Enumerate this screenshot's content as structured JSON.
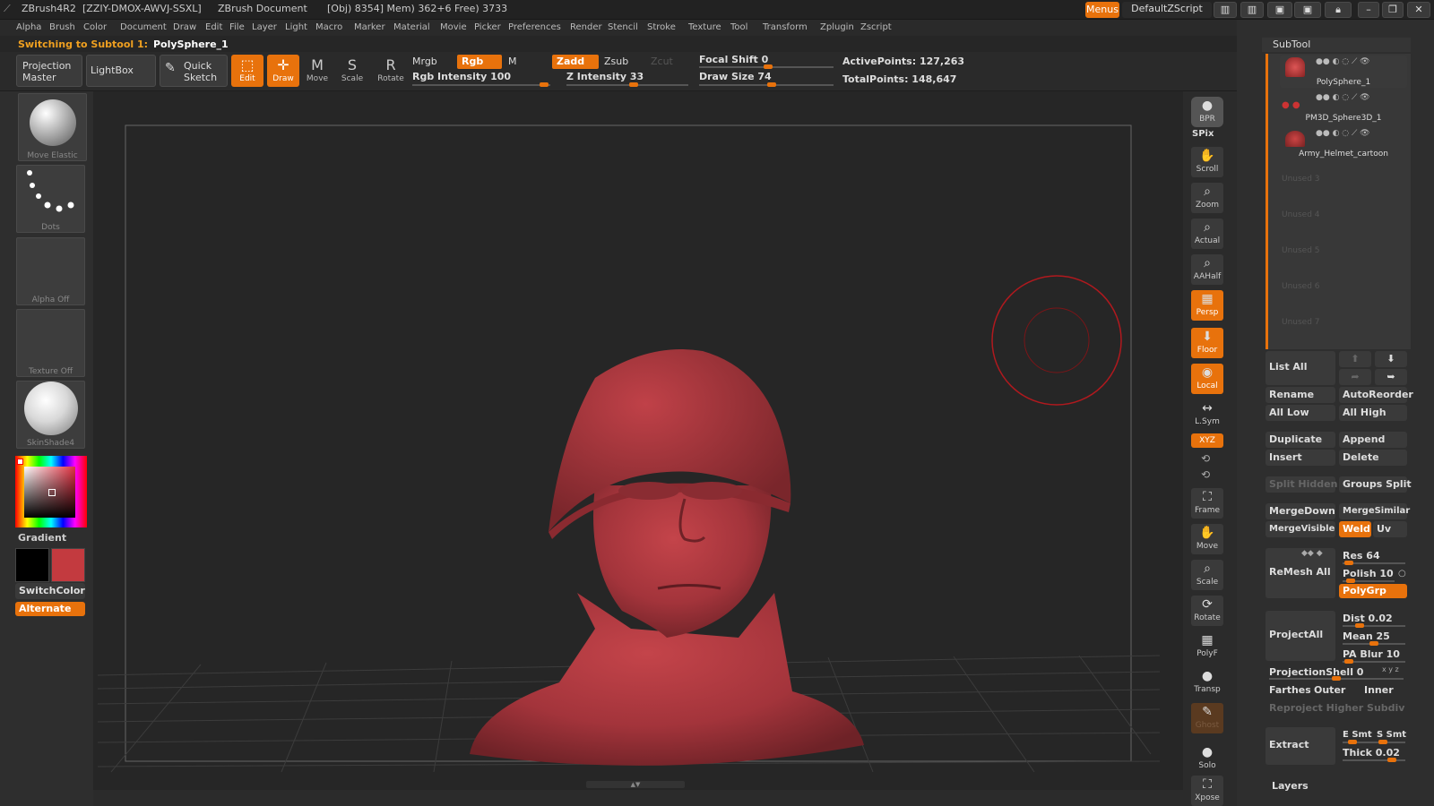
{
  "titlebar": {
    "app": "ZBrush4R2",
    "code": "[ZZIY-DMOX-AWVJ-SSXL]",
    "doc": "ZBrush Document",
    "stats": "[Obj) 8354] Mem) 362+6 Free) 3733",
    "menus_btn": "Menus",
    "script_btn": "DefaultZScript"
  },
  "menubar": [
    "Alpha",
    "Brush",
    "Color",
    "Document",
    "Draw",
    "Edit",
    "File",
    "Layer",
    "Light",
    "Macro",
    "Marker",
    "Material",
    "Movie",
    "Picker",
    "Preferences",
    "Render",
    "Stencil",
    "Stroke",
    "Texture",
    "Tool",
    "Transform",
    "Zplugin",
    "Zscript"
  ],
  "status": {
    "label": "Switching to Subtool 1:",
    "value": "PolySphere_1"
  },
  "toolbar": {
    "projection_master": "Projection Master",
    "lightbox": "LightBox",
    "quick_sketch": "Quick Sketch",
    "edit": "Edit",
    "draw": "Draw",
    "move": "Move",
    "scale": "Scale",
    "rotate": "Rotate",
    "mrgb": "Mrgb",
    "rgb": "Rgb",
    "m": "M",
    "zadd": "Zadd",
    "zsub": "Zsub",
    "zcut": "Zcut",
    "rgb_intensity": "Rgb Intensity 100",
    "z_intensity": "Z Intensity 33",
    "focal_shift": "Focal Shift 0",
    "draw_size": "Draw Size 74",
    "active_points": "ActivePoints: 127,263",
    "total_points": "TotalPoints: 148,647"
  },
  "leftpanel": {
    "brush": "Move Elastic",
    "stroke": "Dots",
    "alpha": "Alpha Off",
    "texture": "Texture Off",
    "material": "SkinShade4",
    "gradient": "Gradient",
    "switchcolor": "SwitchColor",
    "alternate": "Alternate",
    "main_color": "#c33a3f",
    "secondary_color": "#000000"
  },
  "rightstrip": [
    "BPR",
    "SPix",
    "Scroll",
    "Zoom",
    "Actual",
    "AAHalf",
    "Persp",
    "Floor",
    "Local",
    "L.Sym",
    "XYZ",
    "Frame",
    "Move",
    "Scale",
    "Rotate",
    "PolyF",
    "Transp",
    "Ghost",
    "Solo",
    "Xpose"
  ],
  "subtool": {
    "title": "SubTool",
    "items": [
      "PolySphere_1",
      "PM3D_Sphere3D_1",
      "Army_Helmet_cartoon"
    ],
    "unused": [
      "Unused 3",
      "Unused 4",
      "Unused 5",
      "Unused 6",
      "Unused 7"
    ],
    "list_all": "List All",
    "rename": "Rename",
    "autoreorder": "AutoReorder",
    "all_low": "All Low",
    "all_high": "All High",
    "duplicate": "Duplicate",
    "append": "Append",
    "insert": "Insert",
    "delete": "Delete",
    "split_hidden": "Split Hidden",
    "groups_split": "Groups Split",
    "mergedown": "MergeDown",
    "mergesimilar": "MergeSimilar",
    "mergevisible": "MergeVisible",
    "weld": "Weld",
    "uv": "Uv",
    "remesh_all": "ReMesh All",
    "res": "Res 64",
    "polish": "Polish 10",
    "polygrp": "PolyGrp",
    "projectall": "ProjectAll",
    "dist": "Dist 0.02",
    "mean": "Mean 25",
    "pa_blur": "PA Blur 10",
    "projection_shell": "ProjectionShell 0",
    "farthest": "Farthest",
    "outer": "Outer",
    "inner": "Inner",
    "reproject": "Reproject Higher Subdiv",
    "extract": "Extract",
    "e_smt": "E Smt",
    "s_smt": "S Smt",
    "thick": "Thick 0.02",
    "layers": "Layers"
  }
}
